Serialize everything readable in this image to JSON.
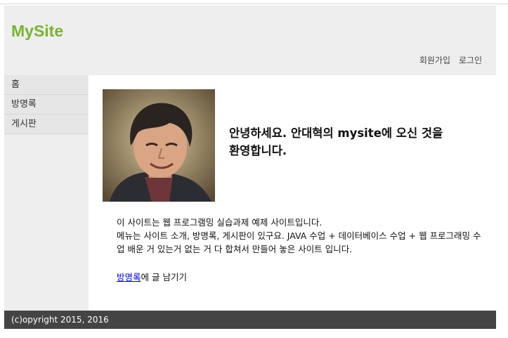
{
  "site": {
    "logo": "MySite"
  },
  "header_nav": {
    "signup": "회원가입",
    "login": "로그인"
  },
  "sidebar": {
    "items": [
      {
        "label": "홈"
      },
      {
        "label": "방명록"
      },
      {
        "label": "게시판"
      }
    ]
  },
  "main": {
    "greeting": "안녕하세요. 안대혁의 mysite에 오신 것을 환영합니다.",
    "description_line1": "이 사이트는 웹 프로그램밍 실습과제 예제 사이트입니다.",
    "description_line2": "메뉴는 사이트 소개, 방명록, 게시판이 있구요. JAVA 수업 + 데이터베이스 수업 + 웹 프로그래밍 수업 배운 거 있는거 없는 거 다 합쳐서 만들어 놓은 사이트 입니다.",
    "guestbook_link": "방명록",
    "guestbook_suffix": "에 글 남기기"
  },
  "footer": {
    "copyright": "(c)opyright 2015, 2016"
  },
  "colors": {
    "logo": "#77b52c",
    "header_bg": "#eeeeee",
    "footer_bg": "#444444",
    "link": "#0000ee"
  }
}
